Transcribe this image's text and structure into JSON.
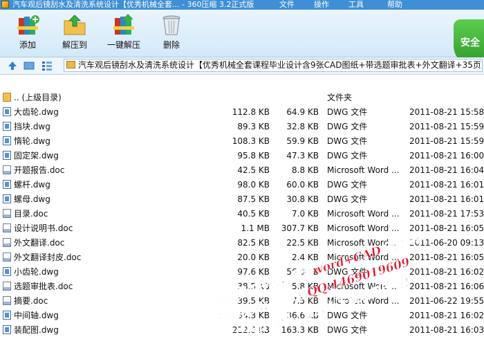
{
  "window": {
    "title": "汽车观后镜刮水及清洗系统设计【优秀机械全套... - 360压缩 3.2正式版",
    "menu": [
      "文件",
      "操作",
      "工具",
      "帮助"
    ]
  },
  "toolbar": {
    "buttons": [
      {
        "label": "添加",
        "icon": "add-books-icon"
      },
      {
        "label": "解压到",
        "icon": "extract-folder-icon"
      },
      {
        "label": "一键解压",
        "icon": "one-click-extract-icon"
      },
      {
        "label": "删除",
        "icon": "trash-icon"
      }
    ],
    "security_label": "安全"
  },
  "address": {
    "path": "汽车观后镜刮水及清洗系统设计【优秀机械全套课程毕业设计含9张CAD图纸+带选题审批表+外文翻译+35页"
  },
  "files": [
    {
      "name": ".. (上级目录)",
      "size": "",
      "compressed": "",
      "type": "文件夹",
      "date": "",
      "kind": "dir"
    },
    {
      "name": "大齿轮.dwg",
      "size": "112.8 KB",
      "compressed": "64.9 KB",
      "type": "DWG 文件",
      "date": "2011-08-21 15:58",
      "kind": "dwg"
    },
    {
      "name": "挡块.dwg",
      "size": "89.3 KB",
      "compressed": "32.8 KB",
      "type": "DWG 文件",
      "date": "2011-08-21 15:59",
      "kind": "dwg"
    },
    {
      "name": "惰轮.dwg",
      "size": "108.3 KB",
      "compressed": "59.9 KB",
      "type": "DWG 文件",
      "date": "2011-08-21 15:59",
      "kind": "dwg"
    },
    {
      "name": "固定架.dwg",
      "size": "95.8 KB",
      "compressed": "47.3 KB",
      "type": "DWG 文件",
      "date": "2011-08-21 16:00",
      "kind": "dwg"
    },
    {
      "name": "开题报告.doc",
      "size": "42.5 KB",
      "compressed": "8.8 KB",
      "type": "Microsoft Word ...",
      "date": "2011-08-21 16:04",
      "kind": "doc"
    },
    {
      "name": "螺杆.dwg",
      "size": "98.0 KB",
      "compressed": "60.0 KB",
      "type": "DWG 文件",
      "date": "2011-08-21 16:01",
      "kind": "dwg"
    },
    {
      "name": "螺母.dwg",
      "size": "87.5 KB",
      "compressed": "30.8 KB",
      "type": "DWG 文件",
      "date": "2011-08-21 16:01",
      "kind": "dwg"
    },
    {
      "name": "目录.doc",
      "size": "40.5 KB",
      "compressed": "7.0 KB",
      "type": "Microsoft Word ...",
      "date": "2011-08-21 17:53",
      "kind": "doc"
    },
    {
      "name": "设计说明书.doc",
      "size": "1.1 MB",
      "compressed": "307.7 KB",
      "type": "Microsoft Word ...",
      "date": "2011-08-21 16:05",
      "kind": "doc"
    },
    {
      "name": "外文翻译.doc",
      "size": "82.5 KB",
      "compressed": "22.5 KB",
      "type": "Microsoft Word ...",
      "date": "2011-06-20 09:13",
      "kind": "doc"
    },
    {
      "name": "外文翻译封皮.doc",
      "size": "20.0 KB",
      "compressed": "2.4 KB",
      "type": "Microsoft Word ...",
      "date": "2011-08-21 16:05",
      "kind": "doc"
    },
    {
      "name": "小齿轮.dwg",
      "size": "97.6 KB",
      "compressed": "56.0 KB",
      "type": "DWG 文件",
      "date": "2011-08-21 16:02",
      "kind": "dwg"
    },
    {
      "name": "选题审批表.doc",
      "size": "38.5 KB",
      "compressed": "5.8 KB",
      "type": "Microsoft Word ...",
      "date": "2011-08-21 16:06",
      "kind": "doc"
    },
    {
      "name": "摘要.doc",
      "size": "39.5 KB",
      "compressed": "7.5 KB",
      "type": "Microsoft Word ...",
      "date": "2011-06-22 19:55",
      "kind": "doc"
    },
    {
      "name": "中间轴.dwg",
      "size": "84.3 KB",
      "compressed": "36.6 KB",
      "type": "DWG 文件",
      "date": "2011-08-21 16:02",
      "kind": "dwg"
    },
    {
      "name": "装配图.dwg",
      "size": "212.8 KB",
      "compressed": "163.3 KB",
      "type": "DWG 文件",
      "date": "2011-08-21 16:03",
      "kind": "dwg"
    }
  ],
  "watermark": {
    "lines": [
      "预览请勿抄袭，原稿word+CAD全套资料",
      "温馨提示：请联系QQ:1469019609",
      "优秀设计资料，请放心下载购买正版！"
    ],
    "color": "#e0162b"
  }
}
